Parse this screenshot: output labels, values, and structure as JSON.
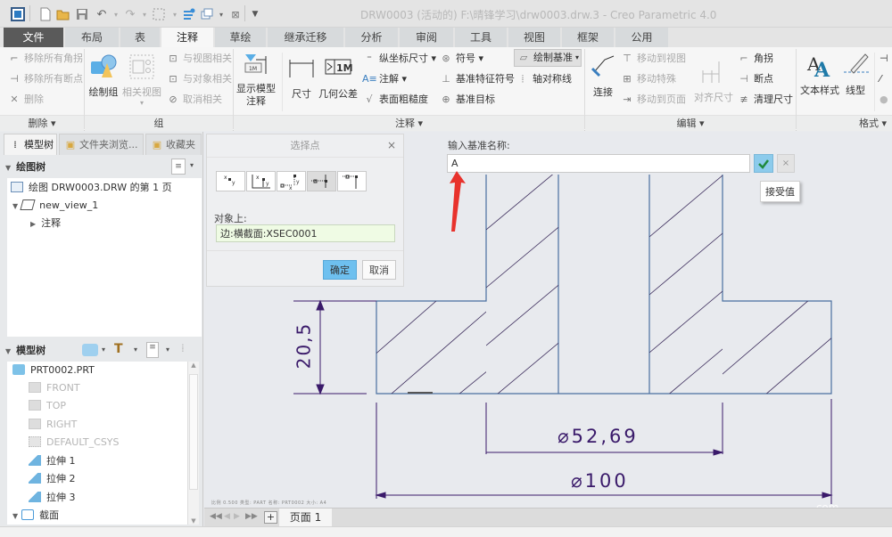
{
  "window": {
    "title": "DRW0003 (活动的) F:\\晴锋学习\\drw0003.drw.3 - Creo Parametric 4.0"
  },
  "quick_access": [
    "app-icon",
    "new-icon",
    "open-icon",
    "save-icon",
    "undo-icon",
    "redo-icon",
    "select-box-icon",
    "regenerate-icon",
    "windows-icon",
    "close-window-icon",
    "customize-icon"
  ],
  "tabs": [
    {
      "label": "文件"
    },
    {
      "label": "布局"
    },
    {
      "label": "表"
    },
    {
      "label": "注释",
      "active": true
    },
    {
      "label": "草绘"
    },
    {
      "label": "继承迁移"
    },
    {
      "label": "分析"
    },
    {
      "label": "审阅"
    },
    {
      "label": "工具"
    },
    {
      "label": "视图"
    },
    {
      "label": "框架"
    },
    {
      "label": "公用"
    }
  ],
  "ribbon": {
    "delete_group": {
      "items": [
        "移除所有角拐",
        "移除所有断点",
        "删除"
      ],
      "footer": "删除 ▾"
    },
    "group_group": {
      "draw_group": "绘制组",
      "related_view": "相关视图",
      "items": [
        "与视图相关",
        "与对象相关",
        "取消相关"
      ],
      "footer": "组"
    },
    "annotation_group": {
      "show_model_annotation": "显示模型\n注释",
      "dimension": "尺寸",
      "gtol": "几何公差",
      "ordinate": "纵坐标尺寸 ▾",
      "note": "注解 ▾",
      "surface_finish": "表面粗糙度",
      "symbol": "符号 ▾",
      "datum_feature": "基准特征符号",
      "datum_target": "基准目标",
      "draw_datum": "绘制基准",
      "axis_symmetry": "轴对称线",
      "footer": "注释 ▾"
    },
    "edit_group": {
      "connect": "连接",
      "items": [
        "移动到视图",
        "移动特殊",
        "移动到页面"
      ],
      "align_dim": "对齐尺寸",
      "jog": "角拐",
      "break": "断点",
      "cleanup": "清理尺寸",
      "footer": "编辑 ▾"
    },
    "format_group": {
      "text_style": "文本样式",
      "line_style": "线型",
      "footer": "格式 ▾"
    }
  },
  "left_panel": {
    "tabs": [
      "模型树",
      "文件夹浏览...",
      "收藏夹"
    ],
    "drawing_tree": {
      "title": "绘图树",
      "items": [
        "绘图 DRW0003.DRW 的第 1 页",
        "new_view_1",
        "注释"
      ]
    },
    "model_tree": {
      "title": "模型树",
      "items": [
        {
          "label": "PRT0002.PRT",
          "dim": false
        },
        {
          "label": "FRONT",
          "dim": true
        },
        {
          "label": "TOP",
          "dim": true
        },
        {
          "label": "RIGHT",
          "dim": true
        },
        {
          "label": "DEFAULT_CSYS",
          "dim": true
        },
        {
          "label": "拉伸 1",
          "dim": false
        },
        {
          "label": "拉伸 2",
          "dim": false
        },
        {
          "label": "拉伸 3",
          "dim": false
        },
        {
          "label": "截面",
          "dim": false
        }
      ]
    }
  },
  "select_point_dialog": {
    "title": "选择点",
    "close": "×",
    "on_object_label": "对象上:",
    "on_object_value": "边:横截面:XSEC0001",
    "ok": "确定",
    "cancel": "取消"
  },
  "datum_input": {
    "label": "输入基准名称:",
    "value": "A",
    "accept_tooltip": "接受值",
    "cancel": "×"
  },
  "drawing": {
    "dim_height": "20,5",
    "dim_inner_dia": "⌀52,69",
    "dim_outer_dia": "⌀100",
    "info_line": "比例 0.500   类型: PART   名称: PRT0002   大小: A4",
    "line_color": "#4a6fa0",
    "dim_color": "#3a1a6a"
  },
  "page_bar": {
    "page_tab": "页面 1",
    "add": "+"
  },
  "watermark": ".com"
}
